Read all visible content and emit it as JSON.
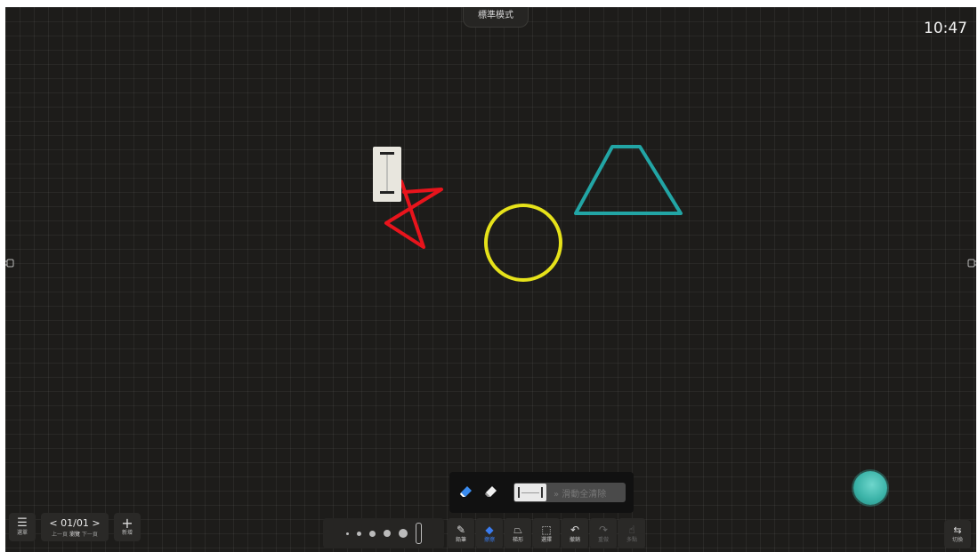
{
  "header": {
    "mode": "標準模式",
    "clock": "10:47"
  },
  "side": {
    "left_icon": "expand-left-icon",
    "right_icon": "expand-right-icon"
  },
  "shapes": {
    "magnet_color": "#e8e6de",
    "star_color": "#e8141c",
    "circle_color": "#e6e21a",
    "trapezoid_color": "#22a5a5"
  },
  "bottom_left": {
    "menu_label": "選單",
    "page_indicator": "< 01/01 >",
    "page_prev": "上一頁",
    "page_browse": "瀏覽",
    "page_next": "下一頁",
    "add_label": "新增"
  },
  "eraser_popup": {
    "slide_text": "» 滑動全清除"
  },
  "tools": [
    {
      "label": "鉛筆",
      "icon": "pencil-icon"
    },
    {
      "label": "擦擦",
      "icon": "eraser-icon"
    },
    {
      "label": "梯形",
      "icon": "shape-icon"
    },
    {
      "label": "選擇",
      "icon": "select-icon"
    },
    {
      "label": "撤銷",
      "icon": "undo-icon"
    },
    {
      "label": "重做",
      "icon": "redo-icon"
    },
    {
      "label": "多點",
      "icon": "multi-touch-icon"
    }
  ],
  "switch_label": "切換",
  "accent_color": "#3a7cf0"
}
